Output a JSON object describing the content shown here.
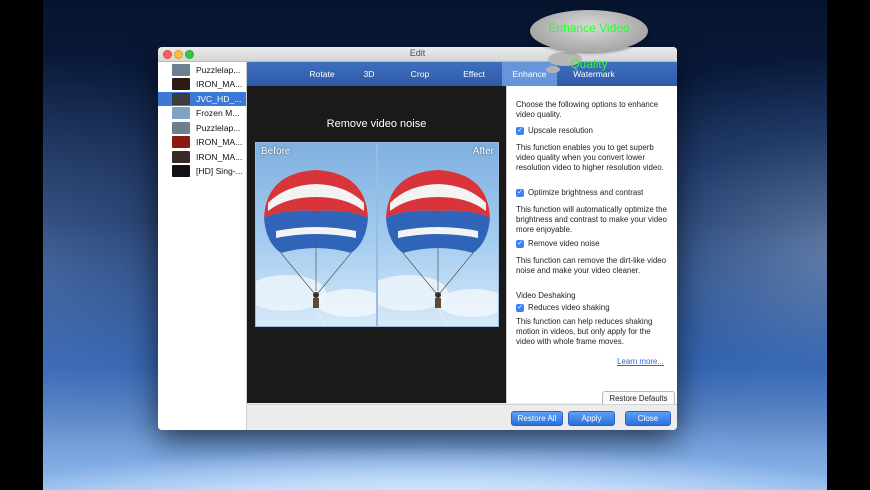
{
  "annotation": {
    "text": "Enhance Video Quality",
    "color": "#26ff2a"
  },
  "window": {
    "title": "Edit"
  },
  "files": [
    {
      "name": "Puzzlelap...",
      "thumb_color": "#6b7f8f"
    },
    {
      "name": "IRON_MA...",
      "thumb_color": "#2c1a14"
    },
    {
      "name": "JVC_HD_...",
      "thumb_color": "#3c3c3c",
      "selected": true
    },
    {
      "name": "Frozen M...",
      "thumb_color": "#7fa2c7"
    },
    {
      "name": "Puzzlelap...",
      "thumb_color": "#6b7f8f"
    },
    {
      "name": "IRON_MA...",
      "thumb_color": "#8a1a12"
    },
    {
      "name": "IRON_MA...",
      "thumb_color": "#3a2a26"
    },
    {
      "name": "[HD] Sing-...",
      "thumb_color": "#111111"
    }
  ],
  "tabs": [
    {
      "label": "Rotate"
    },
    {
      "label": "3D"
    },
    {
      "label": "Crop"
    },
    {
      "label": "Effect"
    },
    {
      "label": "Enhance",
      "active": true
    },
    {
      "label": "Watermark"
    }
  ],
  "preview": {
    "title": "Remove video noise",
    "before_label": "Before",
    "after_label": "After"
  },
  "options": {
    "intro": "Choose the following options to enhance video quality.",
    "upscale": {
      "label": "Upscale resolution",
      "checked": true,
      "desc": "This function enables you to get superb video quality when you convert lower resolution video to higher resolution video."
    },
    "brightness": {
      "label": "Optimize brightness and contrast",
      "checked": true,
      "desc": "This function will automatically optimize the brightness and contrast to make your video more enjoyable."
    },
    "noise": {
      "label": "Remove video noise",
      "checked": true,
      "desc": "This function can remove the dirt-like video noise and make your video cleaner."
    },
    "deshake_heading": "Video Deshaking",
    "deshake": {
      "label": "Reduces video shaking",
      "checked": true,
      "desc": "This function can help reduces shaking motion in videos, but only apply for the video with whole frame moves."
    },
    "learn_more": "Learn more...",
    "restore_defaults": "Restore Defaults"
  },
  "buttons": {
    "restore_all": "Restore All",
    "apply": "Apply",
    "close": "Close"
  },
  "colors": {
    "accent": "#3c78d8",
    "tabbar": "#2f5aa7",
    "active_tab": "#6795db"
  }
}
